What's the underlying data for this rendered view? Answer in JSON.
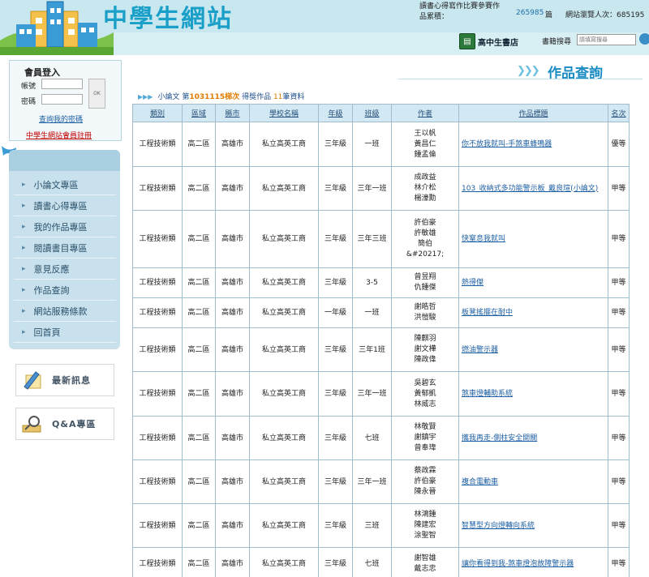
{
  "header": {
    "site_title": "中學生網站",
    "contest_line1": "讀書心得寫作比賽參賽作",
    "contest_line2": "品累積：",
    "contest_count": "265985",
    "contest_unit": "篇",
    "visit_label": "網站瀏覽人次：",
    "visit_count": "685195",
    "bookstore_label": "高中生書店",
    "book_search_label": "書籍搜尋",
    "book_search_placeholder": "請填寫搜尋"
  },
  "login": {
    "title": "會員登入",
    "account_label": "帳號",
    "password_label": "密碼",
    "ok_label": "OK",
    "forgot_link": "查詢我的密碼",
    "register_link": "中學生網站會員註冊"
  },
  "nav": {
    "items": [
      {
        "label": "小論文專區"
      },
      {
        "label": "讀書心得專區"
      },
      {
        "label": "我的作品專區"
      },
      {
        "label": "閱讀書目專區"
      },
      {
        "label": "意見反應"
      },
      {
        "label": "作品查詢"
      },
      {
        "label": "網站服務條款"
      },
      {
        "label": "回首頁"
      }
    ]
  },
  "side_buttons": {
    "news": "最新訊息",
    "qa": "Q&A專區"
  },
  "main": {
    "page_title": "作品查詢",
    "result_prefix": "小論文 第",
    "result_session": "1031115梯次",
    "result_mid": "得獎作品",
    "result_count": "11",
    "result_suffix": "筆資料"
  },
  "table": {
    "columns": [
      "類別",
      "區域",
      "縣市",
      "學校名稱",
      "年級",
      "班級",
      "作者",
      "作品標題",
      "名次"
    ],
    "rows": [
      {
        "category": "工程技術類",
        "region": "高二區",
        "city": "高雄市",
        "school": "私立高英工商",
        "grade": "三年級",
        "class": "一班",
        "authors": [
          "王以帆",
          "黃昌仁",
          "鍾孟倫"
        ],
        "title": "你不放我就叫-手煞車蜂鳴器",
        "rank": "優等"
      },
      {
        "category": "工程技術類",
        "region": "高二區",
        "city": "高雄市",
        "school": "私立高英工商",
        "grade": "三年級",
        "class": "三年一班",
        "authors": [
          "成政益",
          "林介松",
          "楊濠勳"
        ],
        "title": "103_收納式多功能警示板_戴良瑄(小論文)",
        "rank": "甲等"
      },
      {
        "category": "工程技術類",
        "region": "高二區",
        "city": "高雄市",
        "school": "私立高英工商",
        "grade": "三年級",
        "class": "三年三班",
        "authors": [
          "許伯豪",
          "許敏雄",
          "簡伯",
          "&#20217;"
        ],
        "title": "快窒息我就叫",
        "rank": "甲等"
      },
      {
        "category": "工程技術類",
        "region": "高二區",
        "city": "高雄市",
        "school": "私立高英工商",
        "grade": "三年級",
        "class": "3-5",
        "authors": [
          "曾昱翔",
          "仇鍾傑"
        ],
        "title": "熱得傑",
        "rank": "甲等"
      },
      {
        "category": "工程技術類",
        "region": "高二區",
        "city": "高雄市",
        "school": "私立高英工商",
        "grade": "一年級",
        "class": "一班",
        "authors": [
          "謝皓哲",
          "洪愷駿"
        ],
        "title": "板凳搖擺在耐中",
        "rank": "甲等"
      },
      {
        "category": "工程技術類",
        "region": "高二區",
        "city": "高雄市",
        "school": "私立高英工商",
        "grade": "三年級",
        "class": "三年1班",
        "authors": [
          "陳麒羽",
          "謝文樺",
          "陳政偉"
        ],
        "title": "燃油警示器",
        "rank": "甲等"
      },
      {
        "category": "工程技術類",
        "region": "高二區",
        "city": "高雄市",
        "school": "私立高英工商",
        "grade": "三年級",
        "class": "三年一班",
        "authors": [
          "吳碧玄",
          "黃郁凱",
          "林威志"
        ],
        "title": "煞車燈輔助系統",
        "rank": "甲等"
      },
      {
        "category": "工程技術類",
        "region": "高二區",
        "city": "高雄市",
        "school": "私立高英工商",
        "grade": "三年級",
        "class": "七班",
        "authors": [
          "林敬賢",
          "謝鎮宇",
          "曾奉瑋"
        ],
        "title": "攜我再走-側柱安全開關",
        "rank": "甲等"
      },
      {
        "category": "工程技術類",
        "region": "高二區",
        "city": "高雄市",
        "school": "私立高英工商",
        "grade": "三年級",
        "class": "三年一班",
        "authors": [
          "蔡政霖",
          "許伯豪",
          "陳永晉"
        ],
        "title": "複合電動車",
        "rank": "甲等"
      },
      {
        "category": "工程技術類",
        "region": "高二區",
        "city": "高雄市",
        "school": "私立高英工商",
        "grade": "三年級",
        "class": "三班",
        "authors": [
          "林鴻鍾",
          "陳建宏",
          "涂聖智"
        ],
        "title": "智慧型方向燈轉向系統",
        "rank": "甲等"
      },
      {
        "category": "工程技術類",
        "region": "高二區",
        "city": "高雄市",
        "school": "私立高英工商",
        "grade": "三年級",
        "class": "七班",
        "authors": [
          "謝智雄",
          "戴志忠"
        ],
        "title": "讓你看得到我-煞車燈泡故障警示器",
        "rank": "甲等"
      }
    ]
  }
}
